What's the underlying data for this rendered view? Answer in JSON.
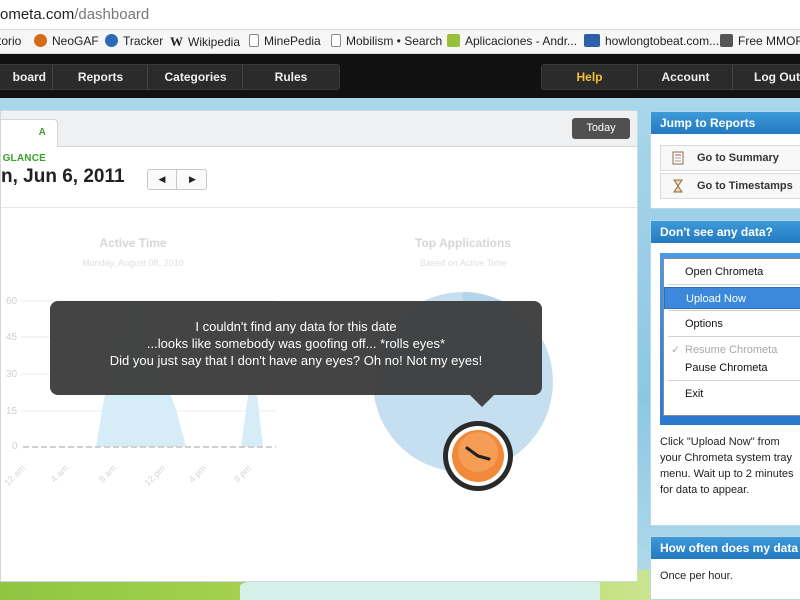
{
  "browser": {
    "url_host": "ometa.com",
    "url_path": "/dashboard",
    "bookmarks": [
      {
        "label": "torio",
        "icon": "",
        "color": ""
      },
      {
        "label": "NeoGAF",
        "icon": "neogaf-icon",
        "color": "#d36b1b"
      },
      {
        "label": "Tracker",
        "icon": "tracker-icon",
        "color": "#2a6ab7"
      },
      {
        "label": "Wikipedia",
        "icon": "wikipedia-icon",
        "color": "#222222"
      },
      {
        "label": "MinePedia",
        "icon": "page-icon",
        "color": "#ffffff"
      },
      {
        "label": "Mobilism • Search",
        "icon": "page-icon",
        "color": "#ffffff"
      },
      {
        "label": "Aplicaciones - Andr...",
        "icon": "android-icon",
        "color": "#97c03d"
      },
      {
        "label": "howlongtobeat.com...",
        "icon": "hltb-icon",
        "color": "#2e5ea8"
      },
      {
        "label": "Free MMORP",
        "icon": "mmorpg-icon",
        "color": "#555555"
      }
    ]
  },
  "nav": {
    "left": [
      "board",
      "Reports",
      "Categories",
      "Rules"
    ],
    "right": [
      "Help",
      "Account",
      "Log Out"
    ]
  },
  "main": {
    "tab_label": "A GLANCE",
    "today_label": "Today",
    "date": "n, Jun 6, 2011",
    "prev_label": "◀",
    "next_label": "▶",
    "active_time": {
      "title": "Active Time",
      "subtitle": "Monday, August 08, 2010",
      "y_ticks": [
        "60",
        "45",
        "30",
        "15",
        "0"
      ],
      "x_ticks": [
        "12 am",
        "4 am",
        "8 am",
        "12 pm",
        "4 pm",
        "8 pm"
      ]
    },
    "top_apps": {
      "title": "Top Applications",
      "subtitle": "Based on Active Time"
    },
    "tooltip": {
      "line1": "I couldn't find any data for this date",
      "line2": "...looks like somebody was goofing off... *rolls eyes*",
      "line3": "Did you just say that I don't have any eyes? Oh no! Not my eyes!"
    }
  },
  "sidebar": {
    "jump": {
      "title": "Jump to Reports",
      "links": [
        "Go to Summary",
        "Go to Timestamps"
      ]
    },
    "no_data": {
      "title": "Don't see any data?",
      "menu": [
        "Open Chrometa",
        "Upload Now",
        "Options",
        "Resume Chrometa",
        "Pause Chrometa",
        "Exit"
      ],
      "text": "Click \"Upload Now\" from your Chrometa system tray menu. Wait up to 2 minutes for data to appear."
    },
    "sync": {
      "title": "How often does my data sync?",
      "text": "Once per hour."
    }
  }
}
